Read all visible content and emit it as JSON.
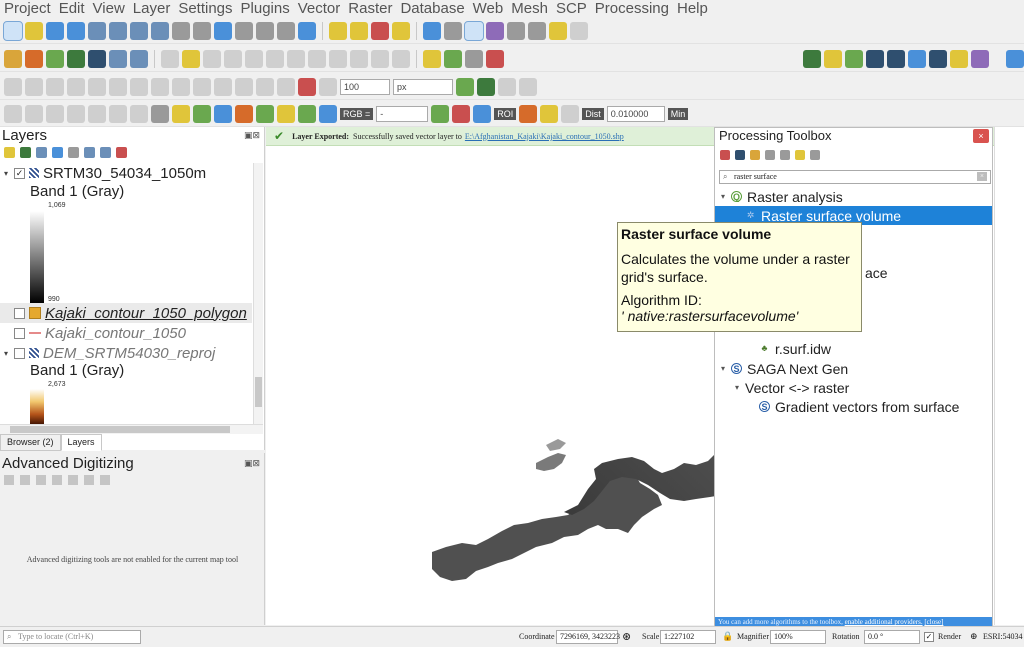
{
  "menu": [
    "Project",
    "Edit",
    "View",
    "Layer",
    "Settings",
    "Plugins",
    "Vector",
    "Raster",
    "Database",
    "Web",
    "Mesh",
    "SCP",
    "Processing",
    "Help"
  ],
  "toolbars": {
    "buffer_value": "100",
    "units": "px",
    "rgb_label": "RGB =",
    "rgb_value": "-",
    "roi_label": "ROI",
    "dist_label": "Dist",
    "dist_value": "0.010000",
    "min_label": "Min"
  },
  "layers_panel": {
    "title": "Layers",
    "layers": [
      {
        "name": "SRTM30_54034_1050m",
        "band": "Band 1 (Gray)",
        "max": "1,069",
        "min": "990"
      },
      {
        "name": "Kajaki_contour_1050_polygon"
      },
      {
        "name": "Kajaki_contour_1050"
      },
      {
        "name": "DEM_SRTM54030_reproj",
        "band": "Band 1 (Gray)",
        "max": "2,673"
      }
    ],
    "tabs": [
      "Browser (2)",
      "Layers"
    ]
  },
  "advanced_digitizing": {
    "title": "Advanced Digitizing",
    "message": "Advanced digitizing tools are not enabled for the current map tool"
  },
  "message_bar": {
    "title": "Layer Exported:",
    "text": "Successfully saved vector layer to",
    "link": "E:\\Afghanistan_Kajaki\\Kajaki_contour_1050.shp"
  },
  "processing": {
    "title": "Processing Toolbox",
    "search_value": "raster surface",
    "tree": [
      {
        "label": "Raster analysis",
        "level": 0,
        "icon": "q"
      },
      {
        "label": "Raster surface volume",
        "level": 1,
        "icon": "gear",
        "selected": true
      },
      {
        "label": "ace",
        "level": 1,
        "icon": "none",
        "partial": true
      },
      {
        "label": "r.surf.idw",
        "level": 2,
        "icon": "grass"
      },
      {
        "label": "SAGA Next Gen",
        "level": 0,
        "icon": "saga"
      },
      {
        "label": "Vector <-> raster",
        "level": 1,
        "icon": "none"
      },
      {
        "label": "Gradient vectors from surface",
        "level": 2,
        "icon": "saga"
      }
    ],
    "footer_text": "You can add more algorithms to the toolbox,",
    "footer_link": "enable additional providers.",
    "footer_close": "[close]"
  },
  "tooltip": {
    "title": "Raster surface volume",
    "description": "Calculates the volume under a raster grid's surface.",
    "id_label": "Algorithm ID:",
    "id_value": "' native:rastersurfacevolume'"
  },
  "statusbar": {
    "locate_placeholder": "Type to locate (Ctrl+K)",
    "coordinate_label": "Coordinate",
    "coordinate": "7296169, 3423223",
    "scale_label": "Scale",
    "scale": "1:227102",
    "magnifier_label": "Magnifier",
    "magnifier": "100%",
    "rotation_label": "Rotation",
    "rotation": "0.0 °",
    "render_label": "Render",
    "crs": "ESRI:54034"
  }
}
